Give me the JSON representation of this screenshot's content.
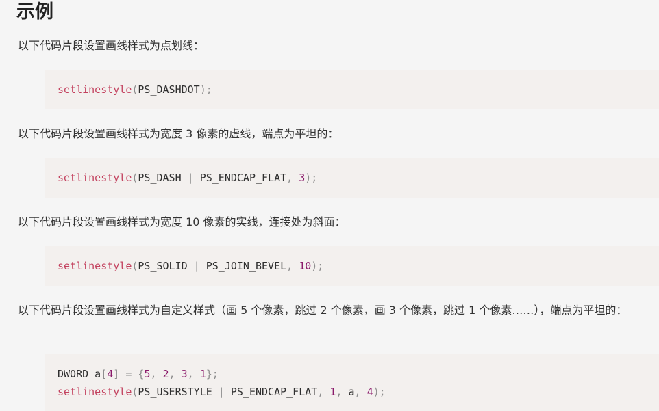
{
  "heading": "示例",
  "examples": [
    {
      "description": "以下代码片段设置画线样式为点划线：",
      "code": {
        "fn": "setlinestyle",
        "open": "(",
        "a1": "PS_DASHDOT",
        "close": ");"
      }
    },
    {
      "description": "以下代码片段设置画线样式为宽度 3 像素的虚线，端点为平坦的：",
      "code": {
        "fn": "setlinestyle",
        "open": "(",
        "a1": "PS_DASH",
        "pipe": " | ",
        "a2": "PS_ENDCAP_FLAT",
        "comma": ", ",
        "n1": "3",
        "close": ");"
      }
    },
    {
      "description": "以下代码片段设置画线样式为宽度 10 像素的实线，连接处为斜面：",
      "code": {
        "fn": "setlinestyle",
        "open": "(",
        "a1": "PS_SOLID",
        "pipe": " | ",
        "a2": "PS_JOIN_BEVEL",
        "comma": ", ",
        "n1": "10",
        "close": ");"
      }
    },
    {
      "description": "以下代码片段设置画线样式为自定义样式（画 5 个像素，跳过 2 个像素，画 3 个像素，跳过 1 个像素……），端点为平坦的：",
      "code_line1": {
        "type": "DWORD",
        "var": " a",
        "lb": "[",
        "size": "4",
        "rb": "]",
        "eq": " = ",
        "lbrace": "{",
        "v1": "5",
        "c1": ", ",
        "v2": "2",
        "c2": ", ",
        "v3": "3",
        "c3": ", ",
        "v4": "1",
        "rbrace": "};"
      },
      "code_line2": {
        "fn": "setlinestyle",
        "open": "(",
        "a1": "PS_USERSTYLE",
        "pipe": " | ",
        "a2": "PS_ENDCAP_FLAT",
        "c1": ", ",
        "n1": "1",
        "c2": ", ",
        "a3": "a",
        "c3": ", ",
        "n2": "4",
        "close": ");"
      }
    }
  ],
  "colors": {
    "function": "#c3415e",
    "number": "#8a1a6a",
    "punctuation": "#8e8e8e",
    "code_background": "#f3f0ee",
    "page_background": "#f5f5f5"
  }
}
